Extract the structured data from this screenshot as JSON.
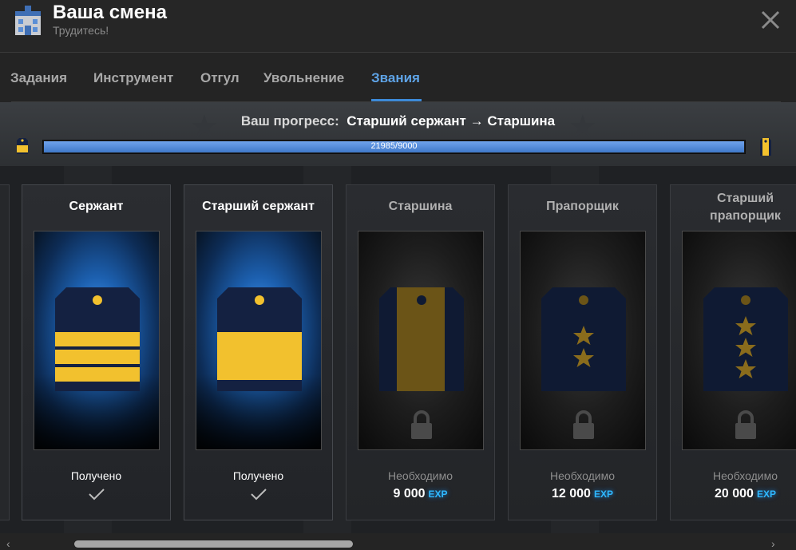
{
  "header": {
    "title": "Ваша смена",
    "subtitle": "Трудитесь!",
    "app_icon": "police-station-icon",
    "close_icon": "close-icon"
  },
  "tabs": [
    {
      "label": "Задания",
      "active": false
    },
    {
      "label": "Инструмент",
      "active": false
    },
    {
      "label": "Отгул",
      "active": false
    },
    {
      "label": "Увольнение",
      "active": false
    },
    {
      "label": "Звания",
      "active": true
    }
  ],
  "progress": {
    "label": "Ваш прогресс:",
    "current_rank": "Старший сержант",
    "arrow": "→",
    "next_rank": "Старшина",
    "bar_text": "21985/9000",
    "fill_fraction": 1.0
  },
  "ranks": [
    {
      "name": "Сержант",
      "state": "unlocked",
      "status": "Получено",
      "cost": "",
      "exp": ""
    },
    {
      "name": "Старший сержант",
      "state": "unlocked",
      "status": "Получено",
      "cost": "",
      "exp": ""
    },
    {
      "name": "Старшина",
      "state": "locked",
      "status": "Необходимо",
      "cost": "9 000",
      "exp": "EXP"
    },
    {
      "name": "Прапорщик",
      "state": "locked",
      "status": "Необходимо",
      "cost": "12 000",
      "exp": "EXP"
    },
    {
      "name": "Старший прапорщик",
      "state": "locked",
      "status": "Необходимо",
      "cost": "20 000",
      "exp": "EXP"
    }
  ],
  "colors": {
    "accent": "#5ea3e6",
    "gold": "#f2c12e",
    "navy": "#142141",
    "exp": "#2fb8ff"
  }
}
